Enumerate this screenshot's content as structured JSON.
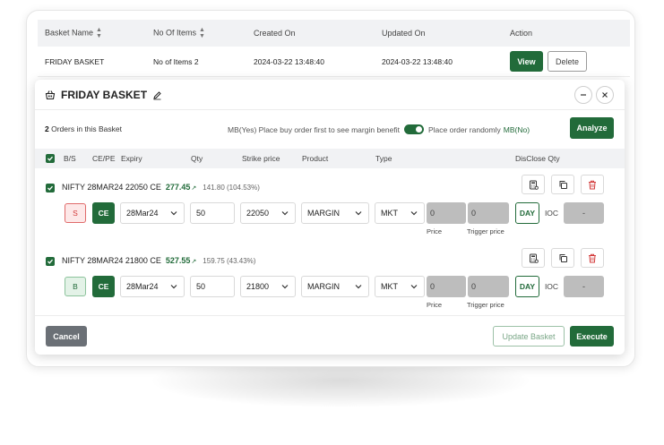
{
  "basket_list": {
    "headers": {
      "basket_name": "Basket Name",
      "no_of_items": "No Of Items",
      "created_on": "Created On",
      "updated_on": "Updated On",
      "action": "Action"
    },
    "row": {
      "name": "FRIDAY BASKET",
      "items": "No of Items 2",
      "created": "2024-03-22 13:48:40",
      "updated": "2024-03-22 13:48:40",
      "view_label": "View",
      "delete_label": "Delete"
    }
  },
  "modal": {
    "title": "FRIDAY BASKET",
    "orders_count": "2",
    "orders_suffix": "Orders in this Basket",
    "mb_yes_text": "MB(Yes) Place buy order first to see margin benefit",
    "random_text": "Place order randomly",
    "mb_no_text": "MB(No)",
    "toggle_on": true,
    "analyze_label": "Analyze",
    "columns": {
      "bs": "B/S",
      "cepe": "CE/PE",
      "expiry": "Expiry",
      "qty": "Qty",
      "strike": "Strike price",
      "product": "Product",
      "type": "Type",
      "disclose": "DisClose Qty"
    },
    "orders": [
      {
        "instrument": "NIFTY 28MAR24 22050 CE",
        "ltp": "277.45",
        "change": "141.80 (104.53%)",
        "side": "S",
        "option_type": "CE",
        "expiry": "28Mar24",
        "qty": "50",
        "strike": "22050",
        "product": "MARGIN",
        "order_type": "MKT",
        "price": "0",
        "trigger": "0",
        "price_label": "Price",
        "trigger_label": "Trigger price",
        "validity_day": "DAY",
        "validity_ioc": "IOC",
        "disclose_qty": "-"
      },
      {
        "instrument": "NIFTY 28MAR24 21800 CE",
        "ltp": "527.55",
        "change": "159.75 (43.43%)",
        "side": "B",
        "option_type": "CE",
        "expiry": "28Mar24",
        "qty": "50",
        "strike": "21800",
        "product": "MARGIN",
        "order_type": "MKT",
        "price": "0",
        "trigger": "0",
        "price_label": "Price",
        "trigger_label": "Trigger price",
        "validity_day": "DAY",
        "validity_ioc": "IOC",
        "disclose_qty": "-"
      }
    ],
    "cancel_label": "Cancel",
    "update_label": "Update Basket",
    "execute_label": "Execute"
  },
  "colors": {
    "accent": "#226b3a",
    "sell": "#d33b3b",
    "muted_grey": "#bdbdbd"
  },
  "icons": {
    "sort": "sort-icon",
    "basket": "basket-icon",
    "edit": "pencil-icon",
    "minimize": "minus-icon",
    "close": "close-icon",
    "arrow_up": "arrow-up-right-icon",
    "calculator": "calculator-icon",
    "copy": "copy-icon",
    "delete": "trash-icon",
    "chevron": "chevron-down-icon",
    "check": "check-icon"
  }
}
